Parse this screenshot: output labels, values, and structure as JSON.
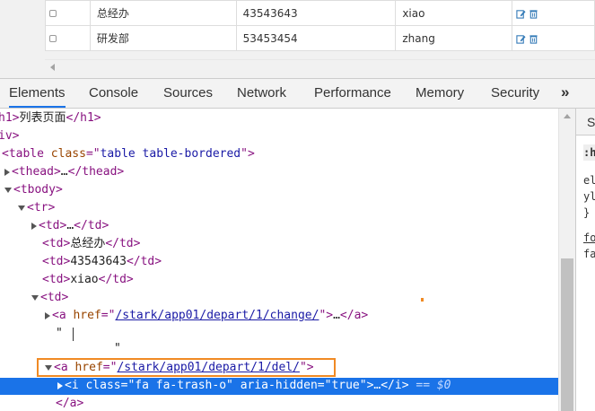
{
  "page_preview": {
    "rows": [
      {
        "name": "总经办",
        "tel": "43543643",
        "user": "xiao"
      },
      {
        "name": "研发部",
        "tel": "53453454",
        "user": "zhang"
      }
    ]
  },
  "devtools": {
    "tabs": [
      "Elements",
      "Console",
      "Sources",
      "Network",
      "Performance",
      "Memory",
      "Security"
    ],
    "active_tab": "Elements",
    "more_tabs": "»"
  },
  "dom": {
    "h1_text": "列表页面",
    "table_class": "table table-bordered",
    "ellipsis": "…",
    "td_name": "总经办",
    "td_tel": "43543643",
    "td_user": "xiao",
    "change_href": "/stark/app01/depart/1/change/",
    "del_href": "/stark/app01/depart/1/del/",
    "text_node": "\" ",
    "text_node_end": "\"",
    "i_class": "fa fa-trash-o",
    "aria_hidden": "true",
    "selected_ref": "== $0"
  },
  "styles_panel": {
    "tab_label": "S",
    "filter_text": ":h",
    "lines": [
      "el",
      "yl",
      "}",
      "fo",
      "fa"
    ]
  },
  "colors": {
    "selection": "#1a73e8",
    "highlight_box": "#f08a24",
    "tag": "#881280",
    "attr": "#994500",
    "value": "#1a1aa6"
  }
}
